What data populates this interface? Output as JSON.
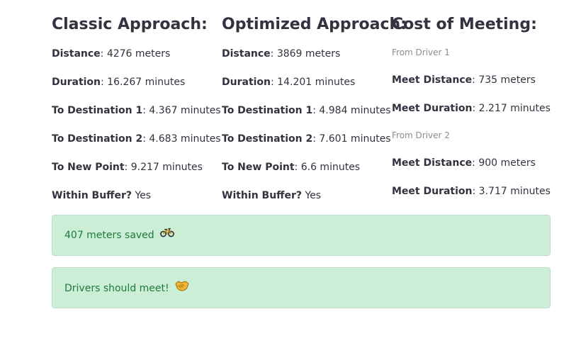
{
  "classic": {
    "title": "Classic Approach:",
    "rows": [
      {
        "label": "Distance",
        "value": ": 4276 meters"
      },
      {
        "label": "Duration",
        "value": ": 16.267 minutes"
      },
      {
        "label": "To Destination 1",
        "value": ": 4.367 minutes"
      },
      {
        "label": "To Destination 2",
        "value": ": 4.683 minutes"
      },
      {
        "label": "To New Point",
        "value": ": 9.217 minutes"
      },
      {
        "label": "Within Buffer?",
        "value": " Yes"
      }
    ]
  },
  "optimized": {
    "title": "Optimized Approach:",
    "rows": [
      {
        "label": "Distance",
        "value": ": 3869 meters"
      },
      {
        "label": "Duration",
        "value": ": 14.201 minutes"
      },
      {
        "label": "To Destination 1",
        "value": ": 4.984 minutes"
      },
      {
        "label": "To Destination 2",
        "value": ": 7.601 minutes"
      },
      {
        "label": "To New Point",
        "value": ": 6.6 minutes"
      },
      {
        "label": "Within Buffer?",
        "value": " Yes"
      }
    ]
  },
  "cost": {
    "title": "Cost of Meeting:",
    "driver1": {
      "caption": "From Driver 1",
      "rows": [
        {
          "label": "Meet Distance",
          "value": ": 735 meters"
        },
        {
          "label": "Meet Duration",
          "value": ": 2.217 minutes"
        }
      ]
    },
    "driver2": {
      "caption": "From Driver 2",
      "rows": [
        {
          "label": "Meet Distance",
          "value": ": 900 meters"
        },
        {
          "label": "Meet Duration",
          "value": ": 3.717 minutes"
        }
      ]
    }
  },
  "alerts": {
    "saved_text": "407 meters saved",
    "saved_icon": "bicycle-icon",
    "meet_text": "Drivers should meet!",
    "meet_icon": "handshake-icon",
    "success_bg": "#cdeed6",
    "success_text": "#1d7a3b"
  }
}
